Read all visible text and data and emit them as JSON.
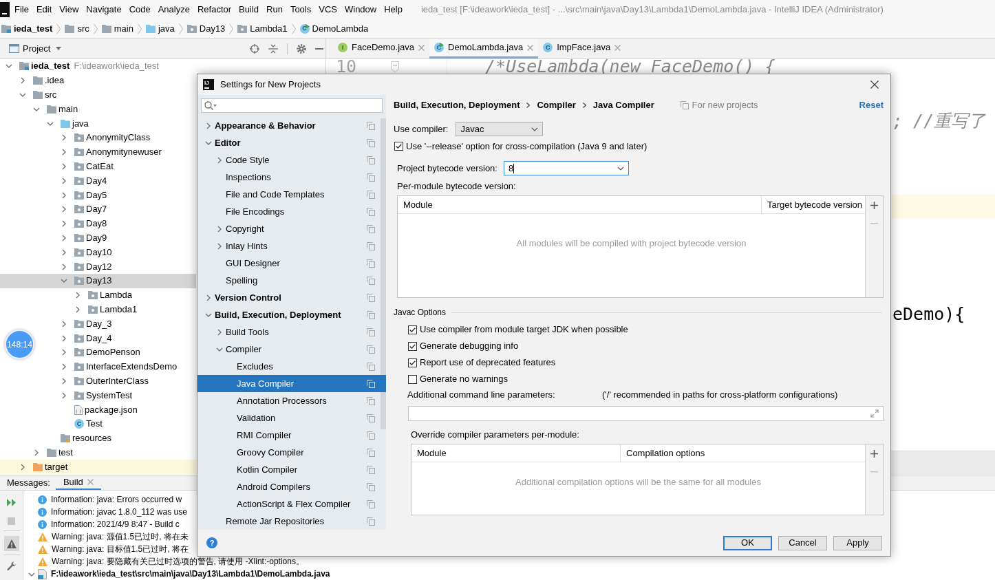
{
  "menu_bar": {
    "items": [
      "File",
      "Edit",
      "View",
      "Navigate",
      "Code",
      "Analyze",
      "Refactor",
      "Build",
      "Run",
      "Tools",
      "VCS",
      "Window",
      "Help"
    ],
    "window_title": "ieda_test [F:\\ideawork\\ieda_test] - ...\\src\\main\\java\\Day13\\Lambda1\\DemoLambda.java - IntelliJ IDEA (Administrator)"
  },
  "navigation_bar": [
    {
      "label": "ieda_test",
      "kind": "module"
    },
    {
      "label": "src",
      "kind": "folder"
    },
    {
      "label": "main",
      "kind": "folder"
    },
    {
      "label": "java",
      "kind": "source-folder"
    },
    {
      "label": "Day13",
      "kind": "package"
    },
    {
      "label": "Lambda1",
      "kind": "package"
    },
    {
      "label": "DemoLambda",
      "kind": "runnable-class",
      "icon_letter": "C"
    }
  ],
  "project_panel": {
    "title": "Project",
    "tree": [
      {
        "label": "ieda_test",
        "path": "F:\\ideawork\\ieda_test",
        "kind": "module",
        "expanded": true,
        "selected": false,
        "children": [
          {
            "label": ".idea",
            "kind": "folder",
            "expanded": false,
            "selected": false
          },
          {
            "label": "src",
            "kind": "folder",
            "expanded": true,
            "selected": false,
            "children": [
              {
                "label": "main",
                "kind": "folder",
                "expanded": true,
                "selected": false,
                "children": [
                  {
                    "label": "java",
                    "kind": "source-folder",
                    "expanded": true,
                    "selected": false,
                    "children": [
                      {
                        "label": "AnonymityClass",
                        "kind": "package",
                        "expanded": false,
                        "selected": false
                      },
                      {
                        "label": "Anonymitynewuser",
                        "kind": "package",
                        "expanded": false,
                        "selected": false
                      },
                      {
                        "label": "CatEat",
                        "kind": "package",
                        "expanded": false,
                        "selected": false
                      },
                      {
                        "label": "Day4",
                        "kind": "package",
                        "expanded": false,
                        "selected": false
                      },
                      {
                        "label": "Day5",
                        "kind": "package",
                        "expanded": false,
                        "selected": false
                      },
                      {
                        "label": "Day7",
                        "kind": "package",
                        "expanded": false,
                        "selected": false
                      },
                      {
                        "label": "Day8",
                        "kind": "package",
                        "expanded": false,
                        "selected": false
                      },
                      {
                        "label": "Day9",
                        "kind": "package",
                        "expanded": false,
                        "selected": false
                      },
                      {
                        "label": "Day10",
                        "kind": "package",
                        "expanded": false,
                        "selected": false
                      },
                      {
                        "label": "Day12",
                        "kind": "package",
                        "expanded": false,
                        "selected": false
                      },
                      {
                        "label": "Day13",
                        "kind": "package",
                        "expanded": true,
                        "selected": true,
                        "children": [
                          {
                            "label": "Lambda",
                            "kind": "package",
                            "expanded": false,
                            "selected": false
                          },
                          {
                            "label": "Lambda1",
                            "kind": "package",
                            "expanded": false,
                            "selected": false
                          }
                        ]
                      },
                      {
                        "label": "Day_3",
                        "kind": "package",
                        "expanded": false,
                        "selected": false
                      },
                      {
                        "label": "Day_4",
                        "kind": "package",
                        "expanded": false,
                        "selected": false
                      },
                      {
                        "label": "DemoPenson",
                        "kind": "package",
                        "expanded": false,
                        "selected": false
                      },
                      {
                        "label": "InterfaceExtendsDemo",
                        "kind": "package",
                        "expanded": false,
                        "selected": false
                      },
                      {
                        "label": "OuterInterClass",
                        "kind": "package",
                        "expanded": false,
                        "selected": false
                      },
                      {
                        "label": "SystemTest",
                        "kind": "package",
                        "expanded": false,
                        "selected": false
                      },
                      {
                        "label": "package.json",
                        "kind": "json-file",
                        "selected": false
                      },
                      {
                        "label": "Test",
                        "kind": "class",
                        "icon_letter": "C",
                        "selected": false
                      }
                    ]
                  },
                  {
                    "label": "resources",
                    "kind": "resources-folder",
                    "selected": false
                  }
                ]
              },
              {
                "label": "test",
                "kind": "folder",
                "expanded": false,
                "selected": false
              }
            ]
          },
          {
            "label": "target",
            "kind": "excluded-folder",
            "expanded": false,
            "selected": false
          }
        ]
      }
    ]
  },
  "editor": {
    "tabs": [
      {
        "label": "FaceDemo.java",
        "kind": "interface",
        "icon_letter": "I",
        "selected": false
      },
      {
        "label": "DemoLambda.java",
        "kind": "runnable-class",
        "icon_letter": "C",
        "selected": true
      },
      {
        "label": "ImpFace.java",
        "kind": "class",
        "icon_letter": "C",
        "selected": false
      }
    ],
    "line_number": "10",
    "lines": [
      {
        "text": "/*UseLambda(new FaceDemo() {",
        "kind": "comment"
      },
      {
        "text": "; //重写了",
        "kind": "comment"
      },
      {
        "text": "eDemo){",
        "kind": "code"
      }
    ]
  },
  "messages_panel": {
    "title": "Messages:",
    "tabs": [
      {
        "label": "Build",
        "selected": true
      }
    ],
    "messages": [
      {
        "kind": "info",
        "text": "Information: java: Errors occurred w"
      },
      {
        "kind": "info",
        "text": "Information: javac 1.8.0_112 was use"
      },
      {
        "kind": "info",
        "text": "Information: 2021/4/9 8:47 - Build c"
      },
      {
        "kind": "warning",
        "text": "Warning: java: 源值1.5已过时, 将在未"
      },
      {
        "kind": "warning",
        "text": "Warning: java: 目标值1.5已过时, 将在"
      },
      {
        "kind": "warning",
        "text": "Warning: java: 要隐藏有关已过时选项的警告, 请使用 -Xlint:-options。"
      },
      {
        "kind": "file",
        "text": "F:\\ideawork\\ieda_test\\src\\main\\java\\Day13\\Lambda1\\DemoLambda.java",
        "expanded": true
      }
    ]
  },
  "timer_badge": "148:14",
  "settings_dialog": {
    "logo": "IJ",
    "title": "Settings for New Projects",
    "nav_tree": [
      {
        "label": "Appearance & Behavior",
        "expanded": false,
        "selected": false
      },
      {
        "label": "Editor",
        "expanded": true,
        "selected": false,
        "children": [
          {
            "label": "Code Style",
            "expanded": false,
            "selected": false
          },
          {
            "label": "Inspections",
            "selected": false
          },
          {
            "label": "File and Code Templates",
            "selected": false
          },
          {
            "label": "File Encodings",
            "selected": false
          },
          {
            "label": "Copyright",
            "expanded": false,
            "selected": false
          },
          {
            "label": "Inlay Hints",
            "expanded": false,
            "selected": false
          },
          {
            "label": "GUI Designer",
            "selected": false
          },
          {
            "label": "Spelling",
            "selected": false
          }
        ]
      },
      {
        "label": "Version Control",
        "expanded": false,
        "selected": false
      },
      {
        "label": "Build, Execution, Deployment",
        "expanded": true,
        "selected": false,
        "children": [
          {
            "label": "Build Tools",
            "expanded": false,
            "selected": false
          },
          {
            "label": "Compiler",
            "expanded": true,
            "selected": false,
            "children": [
              {
                "label": "Excludes",
                "selected": false
              },
              {
                "label": "Java Compiler",
                "selected": true
              },
              {
                "label": "Annotation Processors",
                "selected": false
              },
              {
                "label": "Validation",
                "selected": false
              },
              {
                "label": "RMI Compiler",
                "selected": false
              },
              {
                "label": "Groovy Compiler",
                "selected": false
              },
              {
                "label": "Kotlin Compiler",
                "selected": false
              },
              {
                "label": "Android Compilers",
                "selected": false
              },
              {
                "label": "ActionScript & Flex Compiler",
                "selected": false
              }
            ]
          },
          {
            "label": "Remote Jar Repositories",
            "selected": false
          }
        ]
      }
    ],
    "breadcrumb": [
      "Build, Execution, Deployment",
      "Compiler",
      "Java Compiler"
    ],
    "scope_note": "For new projects",
    "reset_link": "Reset",
    "use_compiler": {
      "label": "Use compiler:",
      "value": "Javac"
    },
    "release_option": {
      "label": "Use '--release' option for cross-compilation (Java 9 and later)",
      "checked": true
    },
    "project_bytecode_version": {
      "label": "Project bytecode version:",
      "value": "8"
    },
    "per_module_bytecode": {
      "label": "Per-module bytecode version:",
      "columns": [
        "Module",
        "Target bytecode version"
      ],
      "empty_text": "All modules will be compiled with project bytecode version"
    },
    "javac_options": {
      "title": "Javac Options",
      "options": [
        {
          "label": "Use compiler from module target JDK when possible",
          "checked": true
        },
        {
          "label": "Generate debugging info",
          "checked": true
        },
        {
          "label": "Report use of deprecated features",
          "checked": true
        },
        {
          "label": "Generate no warnings",
          "checked": false
        }
      ],
      "additional_parameters": {
        "label": "Additional command line parameters:",
        "note": "('/' recommended in paths for cross-platform configurations)"
      },
      "override_per_module": {
        "label": "Override compiler parameters per-module:",
        "columns": [
          "Module",
          "Compilation options"
        ],
        "empty_text": "Additional compilation options will be the same for all modules"
      }
    },
    "help_button": "?",
    "buttons": [
      {
        "label": "OK",
        "default": true
      },
      {
        "label": "Cancel",
        "default": false
      },
      {
        "label": "Apply",
        "default": false
      }
    ]
  }
}
